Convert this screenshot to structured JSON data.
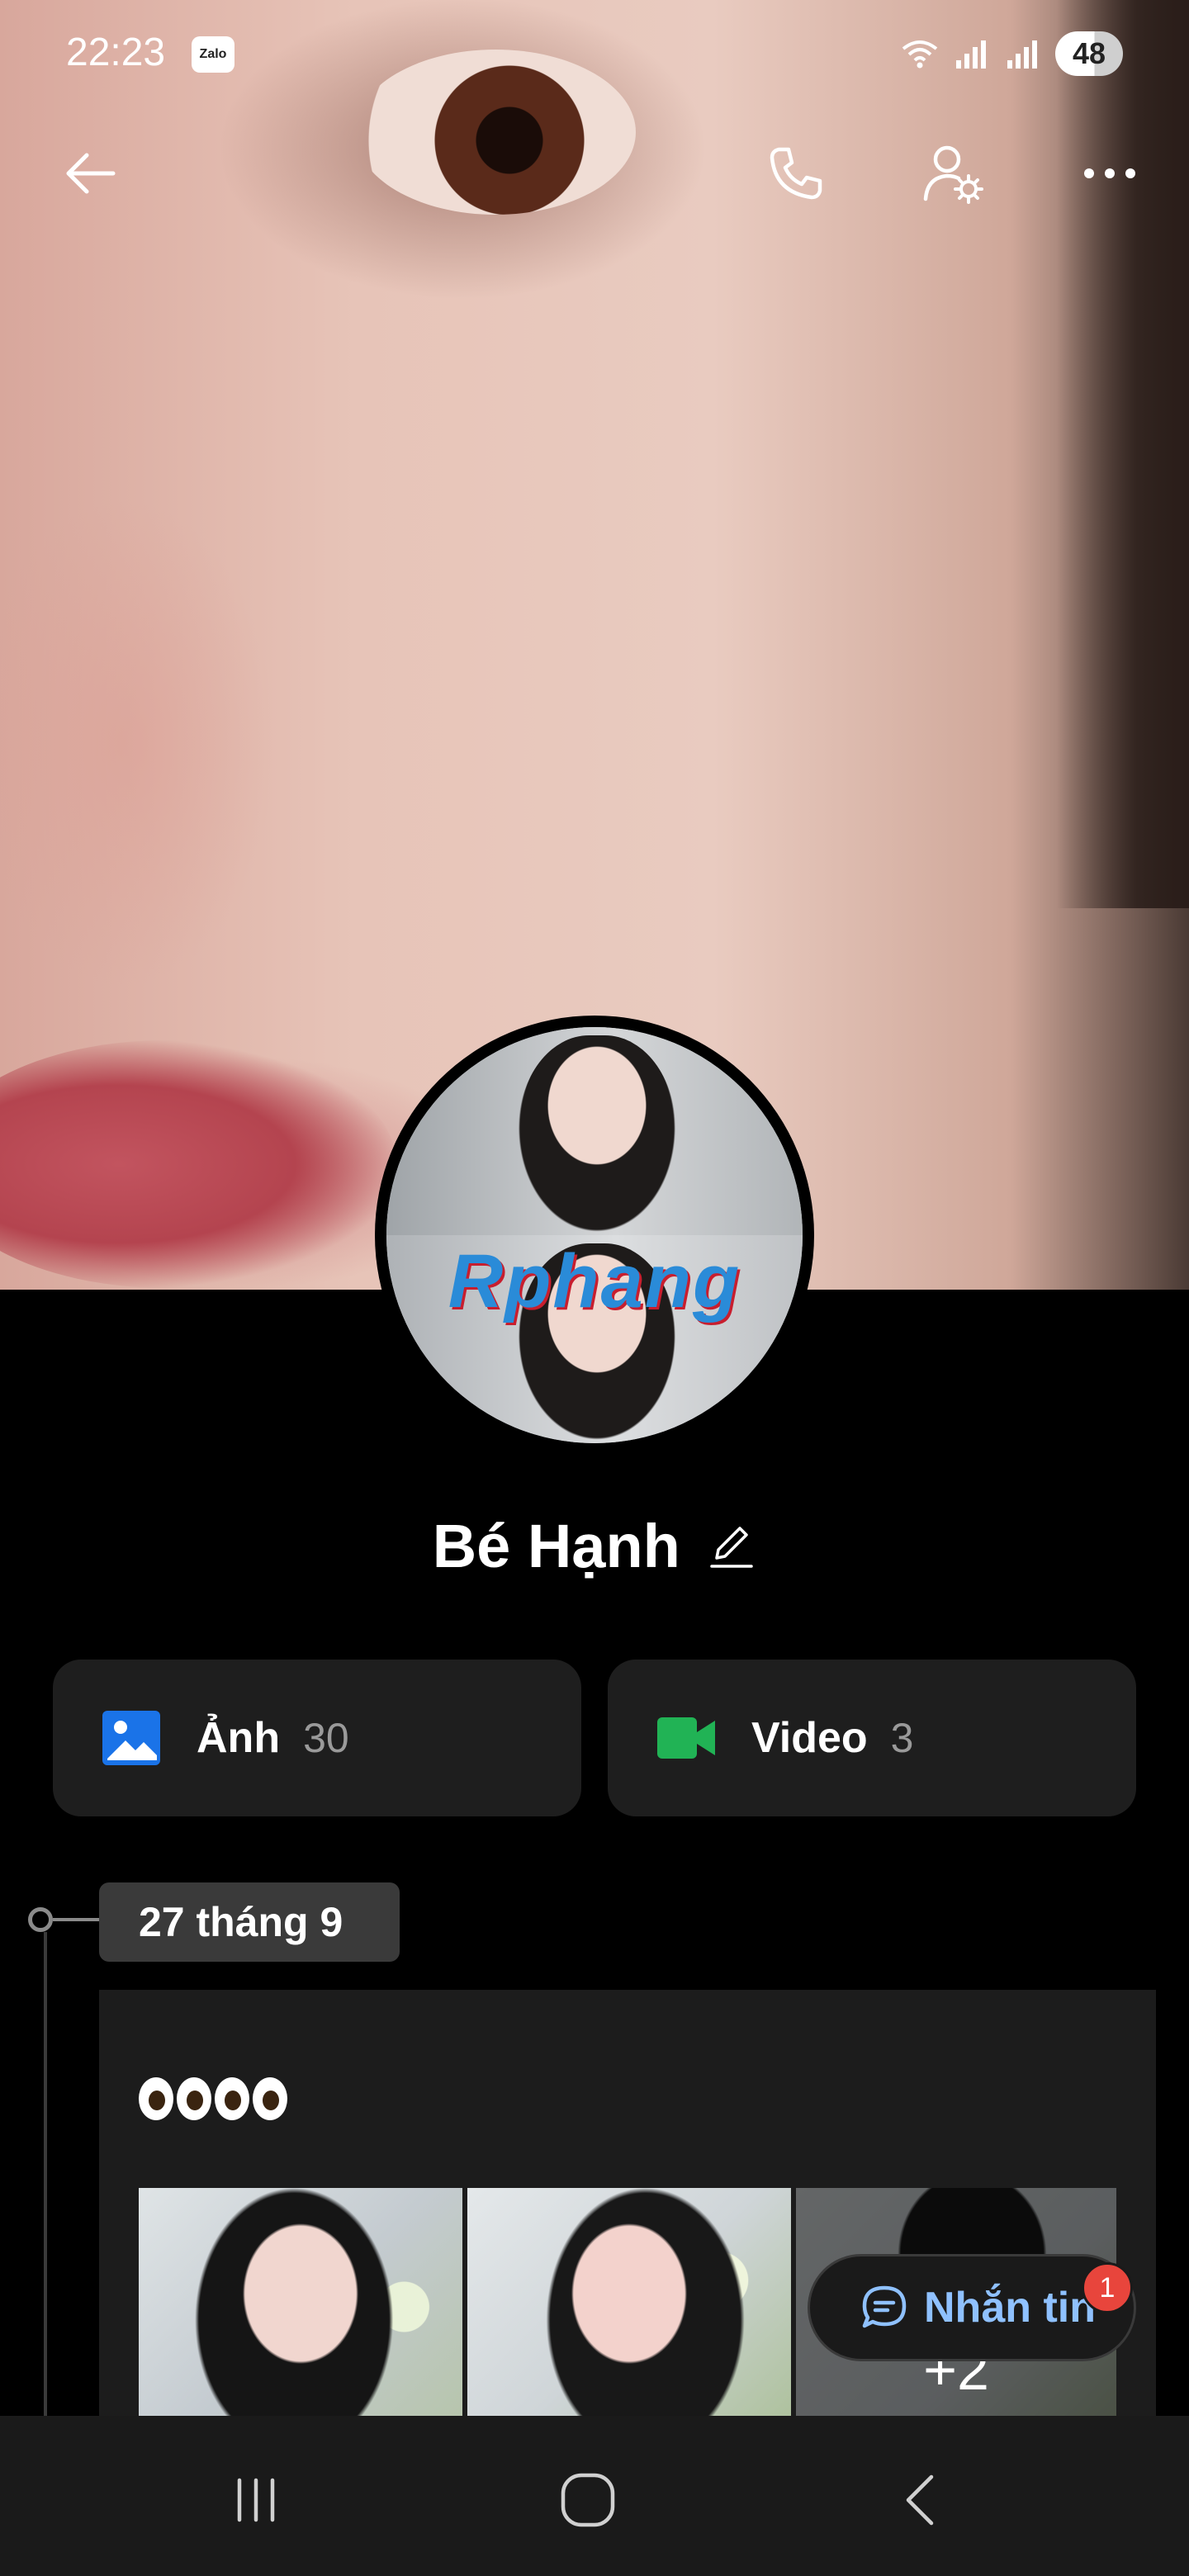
{
  "status_bar": {
    "time": "22:23",
    "app_badge": "Zalo",
    "battery": "48"
  },
  "profile": {
    "name": "Bé Hạnh",
    "avatar_watermark": "Rphang"
  },
  "media": {
    "photos_label": "Ảnh",
    "photos_count": "30",
    "videos_label": "Video",
    "videos_count": "3"
  },
  "timeline": {
    "date": "27 tháng 9",
    "post_text": "👀👀",
    "more_count": "+2"
  },
  "message_button": {
    "label": "Nhắn tin",
    "badge": "1"
  },
  "colors": {
    "accent_blue": "#8fc1ff",
    "photo_icon": "#1a73e8",
    "video_icon": "#21b355",
    "badge_red": "#e8453c"
  },
  "icons": [
    "back-icon",
    "phone-icon",
    "user-settings-icon",
    "more-icon",
    "edit-icon",
    "image-icon",
    "video-camera-icon",
    "chat-icon",
    "recents-icon",
    "home-icon",
    "nav-back-icon"
  ]
}
